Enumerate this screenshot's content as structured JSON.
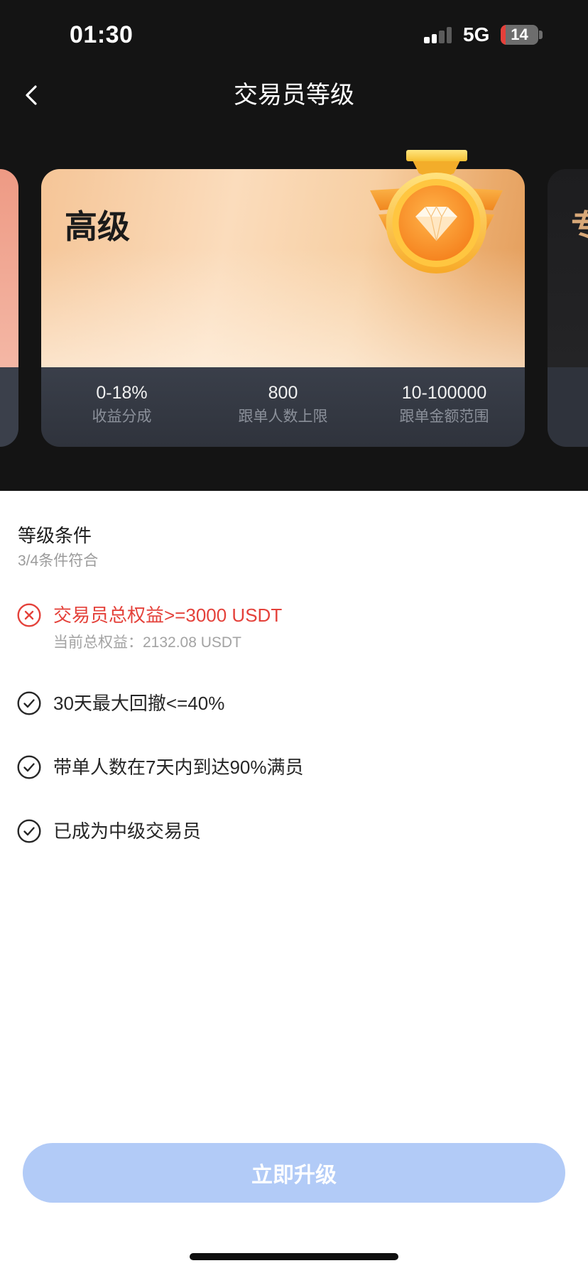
{
  "status_bar": {
    "time": "01:30",
    "network": "5G",
    "battery": "14",
    "signal_level": 2,
    "signal_max": 4
  },
  "header": {
    "title": "交易员等级",
    "back_icon": "chevron-left-icon"
  },
  "levels": {
    "current": {
      "name": "高级",
      "badge_icon": "diamond-medal-icon",
      "stats": [
        {
          "value": "0-18%",
          "label": "收益分成"
        },
        {
          "value": "800",
          "label": "跟单人数上限"
        },
        {
          "value": "10-100000",
          "label": "跟单金额范围"
        }
      ]
    },
    "next": {
      "name": "专"
    }
  },
  "conditions": {
    "title": "等级条件",
    "summary": "3/4条件符合",
    "items": [
      {
        "text": "交易员总权益>=3000 USDT",
        "detail": "当前总权益：2132.08 USDT",
        "met": false,
        "icon": "x-circle-icon"
      },
      {
        "text": "30天最大回撤<=40%",
        "met": true,
        "icon": "check-circle-icon"
      },
      {
        "text": "带单人数在7天内到达90%满员",
        "met": true,
        "icon": "check-circle-icon"
      },
      {
        "text": "已成为中级交易员",
        "met": true,
        "icon": "check-circle-icon"
      }
    ]
  },
  "upgrade_button": {
    "label": "立即升级",
    "enabled": false
  },
  "colors": {
    "header_background": "#141414",
    "unmet_red": "#e4413a",
    "met_icon": "#262626",
    "button_disabled": "#b2cbf7",
    "battery_low": "#e5403a"
  }
}
